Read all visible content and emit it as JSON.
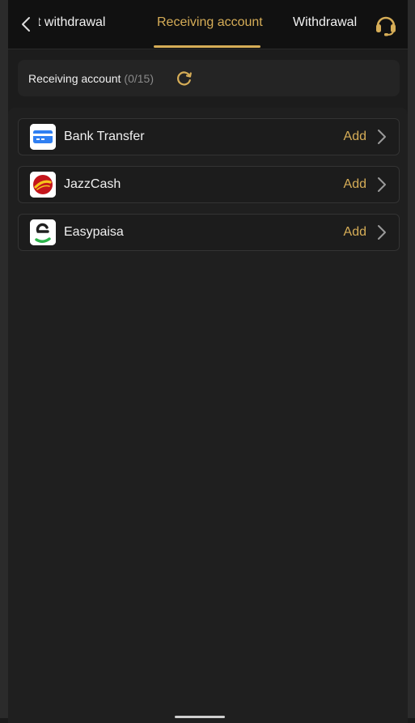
{
  "header": {
    "back_icon": "chevron-left-icon",
    "tabs": [
      {
        "label": "st withdrawal"
      },
      {
        "label": "Receiving account"
      },
      {
        "label": "Withdrawal l"
      }
    ],
    "active_tab": "Receiving account",
    "support_icon": "headset-icon"
  },
  "summary": {
    "label": "Receiving account",
    "count": "(0/15)",
    "refresh_icon": "refresh-icon"
  },
  "accounts": [
    {
      "name": "Bank Transfer",
      "action": "Add",
      "icon": "bank-card-icon"
    },
    {
      "name": "JazzCash",
      "action": "Add",
      "icon": "jazzcash-logo-icon"
    },
    {
      "name": "Easypaisa",
      "action": "Add",
      "icon": "easypaisa-logo-icon"
    }
  ],
  "colors": {
    "accent": "#d6ad57",
    "background": "#1c1c1c",
    "topbar": "#111111"
  }
}
